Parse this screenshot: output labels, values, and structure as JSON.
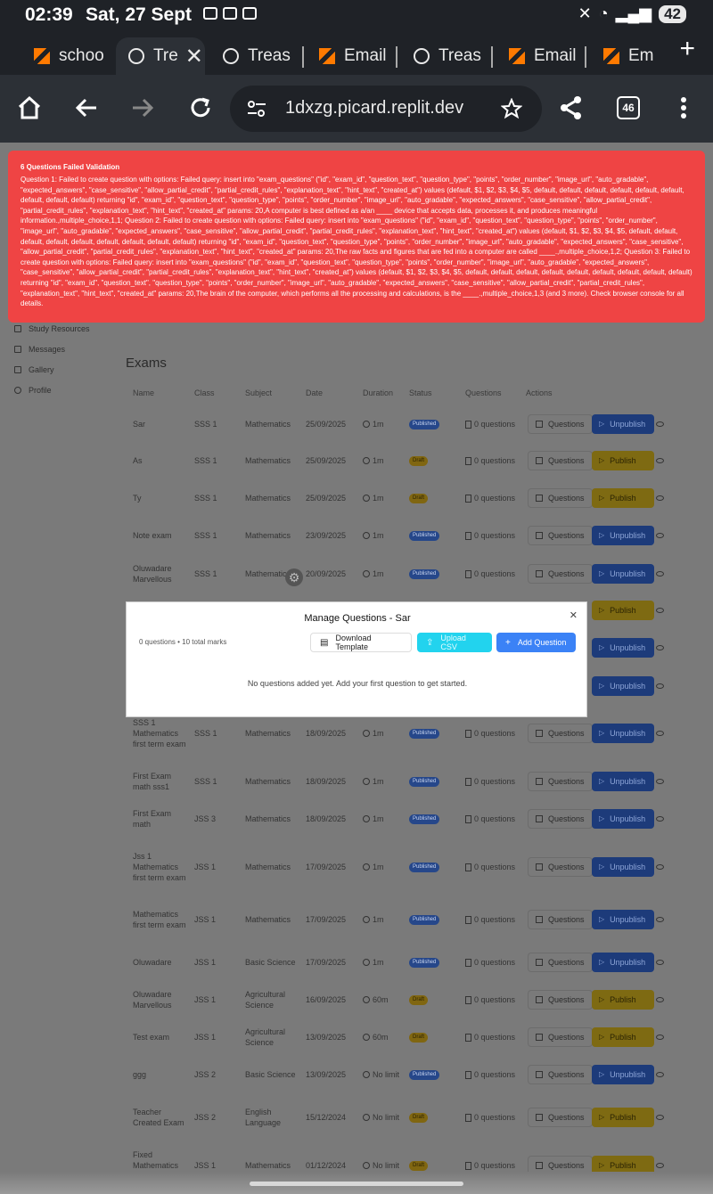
{
  "status_bar": {
    "time": "02:39",
    "date": "Sat, 27 Sept",
    "battery": "42"
  },
  "tabs": [
    {
      "label": "schoo",
      "icon": "replit-icon"
    },
    {
      "label": "Tre",
      "icon": "globe-icon",
      "active": true
    },
    {
      "label": "Treas",
      "icon": "globe-icon"
    },
    {
      "label": "Email",
      "icon": "replit-icon"
    },
    {
      "label": "Treas",
      "icon": "globe-icon"
    },
    {
      "label": "Email",
      "icon": "replit-icon"
    },
    {
      "label": "Em",
      "icon": "replit-icon"
    }
  ],
  "address_bar": {
    "url": "1dxzg.picard.replit.dev",
    "tab_count": "46"
  },
  "toast": {
    "title": "6 Questions Failed Validation",
    "body": "Question 1: Failed to create question with options: Failed query: insert into \"exam_questions\" (\"id\", \"exam_id\", \"question_text\", \"question_type\", \"points\", \"order_number\", \"image_url\", \"auto_gradable\", \"expected_answers\", \"case_sensitive\", \"allow_partial_credit\", \"partial_credit_rules\", \"explanation_text\", \"hint_text\", \"created_at\") values (default, $1, $2, $3, $4, $5, default, default, default, default, default, default, default, default, default) returning \"id\", \"exam_id\", \"question_text\", \"question_type\", \"points\", \"order_number\", \"image_url\", \"auto_gradable\", \"expected_answers\", \"case_sensitive\", \"allow_partial_credit\", \"partial_credit_rules\", \"explanation_text\", \"hint_text\", \"created_at\" params: 20,A computer is best defined as a/an ____ device that accepts data, processes it, and produces meaningful information.,multiple_choice,1,1; Question 2: Failed to create question with options: Failed query: insert into \"exam_questions\" (\"id\", \"exam_id\", \"question_text\", \"question_type\", \"points\", \"order_number\", \"image_url\", \"auto_gradable\", \"expected_answers\", \"case_sensitive\", \"allow_partial_credit\", \"partial_credit_rules\", \"explanation_text\", \"hint_text\", \"created_at\") values (default, $1, $2, $3, $4, $5, default, default, default, default, default, default, default, default, default) returning \"id\", \"exam_id\", \"question_text\", \"question_type\", \"points\", \"order_number\", \"image_url\", \"auto_gradable\", \"expected_answers\", \"case_sensitive\", \"allow_partial_credit\", \"partial_credit_rules\", \"explanation_text\", \"hint_text\", \"created_at\" params: 20,The raw facts and figures that are fed into a computer are called ____.,multiple_choice,1,2; Question 3: Failed to create question with options: Failed query: insert into \"exam_questions\" (\"id\", \"exam_id\", \"question_text\", \"question_type\", \"points\", \"order_number\", \"image_url\", \"auto_gradable\", \"expected_answers\", \"case_sensitive\", \"allow_partial_credit\", \"partial_credit_rules\", \"explanation_text\", \"hint_text\", \"created_at\") values (default, $1, $2, $3, $4, $5, default, default, default, default, default, default, default, default, default) returning \"id\", \"exam_id\", \"question_text\", \"question_type\", \"points\", \"order_number\", \"image_url\", \"auto_gradable\", \"expected_answers\", \"case_sensitive\", \"allow_partial_credit\", \"partial_credit_rules\", \"explanation_text\", \"hint_text\", \"created_at\" params: 20,The brain of the computer, which performs all the processing and calculations, is the ____.,multiple_choice,1,3 (and 3 more). Check browser console for all details."
  },
  "sidebar": {
    "items": [
      {
        "label": "Study Resources",
        "icon": "book-icon"
      },
      {
        "label": "Messages",
        "icon": "message-icon"
      },
      {
        "label": "Gallery",
        "icon": "image-icon"
      },
      {
        "label": "Profile",
        "icon": "user-icon"
      }
    ]
  },
  "exams": {
    "title": "Exams",
    "headers": [
      "Name",
      "Class",
      "Subject",
      "Date",
      "Duration",
      "Status",
      "Questions",
      "Actions"
    ],
    "questions_button": "Questions",
    "rows": [
      {
        "name": "Sar",
        "class": "SSS 1",
        "subject": "Mathematics",
        "date": "25/09/2025",
        "duration": "1m",
        "status": "Published",
        "questions": "0 questions",
        "action": "Unpublish"
      },
      {
        "name": "As",
        "class": "SSS 1",
        "subject": "Mathematics",
        "date": "25/09/2025",
        "duration": "1m",
        "status": "Draft",
        "questions": "0 questions",
        "action": "Publish"
      },
      {
        "name": "Ty",
        "class": "SSS 1",
        "subject": "Mathematics",
        "date": "25/09/2025",
        "duration": "1m",
        "status": "Draft",
        "questions": "0 questions",
        "action": "Publish"
      },
      {
        "name": "Note exam",
        "class": "SSS 1",
        "subject": "Mathematics",
        "date": "23/09/2025",
        "duration": "1m",
        "status": "Published",
        "questions": "0 questions",
        "action": "Unpublish"
      },
      {
        "name": "Oluwadare Marvellous",
        "class": "SSS 1",
        "subject": "Mathematics",
        "date": "20/09/2025",
        "duration": "1m",
        "status": "Published",
        "questions": "0 questions",
        "action": "Unpublish"
      },
      {
        "name": "",
        "class": "",
        "subject": "",
        "date": "",
        "duration": "",
        "status": "",
        "questions": "",
        "action": "Publish"
      },
      {
        "name": "",
        "class": "",
        "subject": "",
        "date": "",
        "duration": "",
        "status": "",
        "questions": "",
        "action": "Unpublish"
      },
      {
        "name": "",
        "class": "",
        "subject": "",
        "date": "",
        "duration": "",
        "status": "",
        "questions": "",
        "action": "Unpublish"
      },
      {
        "name": "SSS 1 Mathematics first term exam",
        "class": "SSS 1",
        "subject": "Mathematics",
        "date": "18/09/2025",
        "duration": "1m",
        "status": "Published",
        "questions": "0 questions",
        "action": "Unpublish"
      },
      {
        "name": "First Exam math sss1",
        "class": "SSS 1",
        "subject": "Mathematics",
        "date": "18/09/2025",
        "duration": "1m",
        "status": "Published",
        "questions": "0 questions",
        "action": "Unpublish"
      },
      {
        "name": "First Exam math",
        "class": "JSS 3",
        "subject": "Mathematics",
        "date": "18/09/2025",
        "duration": "1m",
        "status": "Published",
        "questions": "0 questions",
        "action": "Unpublish"
      },
      {
        "name": "Jss 1 Mathematics first term exam",
        "class": "JSS 1",
        "subject": "Mathematics",
        "date": "17/09/2025",
        "duration": "1m",
        "status": "Published",
        "questions": "0 questions",
        "action": "Unpublish"
      },
      {
        "name": "Mathematics first term exam",
        "class": "JSS 1",
        "subject": "Mathematics",
        "date": "17/09/2025",
        "duration": "1m",
        "status": "Published",
        "questions": "0 questions",
        "action": "Unpublish"
      },
      {
        "name": "Oluwadare",
        "class": "JSS 1",
        "subject": "Basic Science",
        "date": "17/09/2025",
        "duration": "1m",
        "status": "Published",
        "questions": "0 questions",
        "action": "Unpublish"
      },
      {
        "name": "Oluwadare Marvellous",
        "class": "JSS 1",
        "subject": "Agricultural Science",
        "date": "16/09/2025",
        "duration": "60m",
        "status": "Draft",
        "questions": "0 questions",
        "action": "Publish"
      },
      {
        "name": "Test exam",
        "class": "JSS 1",
        "subject": "Agricultural Science",
        "date": "13/09/2025",
        "duration": "60m",
        "status": "Draft",
        "questions": "0 questions",
        "action": "Publish"
      },
      {
        "name": "ggg",
        "class": "JSS 2",
        "subject": "Basic Science",
        "date": "13/09/2025",
        "duration": "No limit",
        "status": "Published",
        "questions": "0 questions",
        "action": "Unpublish"
      },
      {
        "name": "Teacher Created Exam",
        "class": "JSS 2",
        "subject": "English Language",
        "date": "15/12/2024",
        "duration": "No limit",
        "status": "Draft",
        "questions": "0 questions",
        "action": "Publish"
      },
      {
        "name": "Fixed Mathematics Exam",
        "class": "JSS 1",
        "subject": "Mathematics",
        "date": "01/12/2024",
        "duration": "No limit",
        "status": "Draft",
        "questions": "0 questions",
        "action": "Publish"
      }
    ]
  },
  "modal": {
    "title": "Manage Questions - Sar",
    "count": "0 questions • 10 total marks",
    "download_label": "Download Template",
    "upload_label": "Upload CSV",
    "add_label": "Add Question",
    "empty_text": "No questions added yet. Add your first question to get started."
  },
  "colors": {
    "toast_bg": "#ef4444",
    "add_button": "#3b82f6",
    "upload_button": "#22d3ee"
  }
}
